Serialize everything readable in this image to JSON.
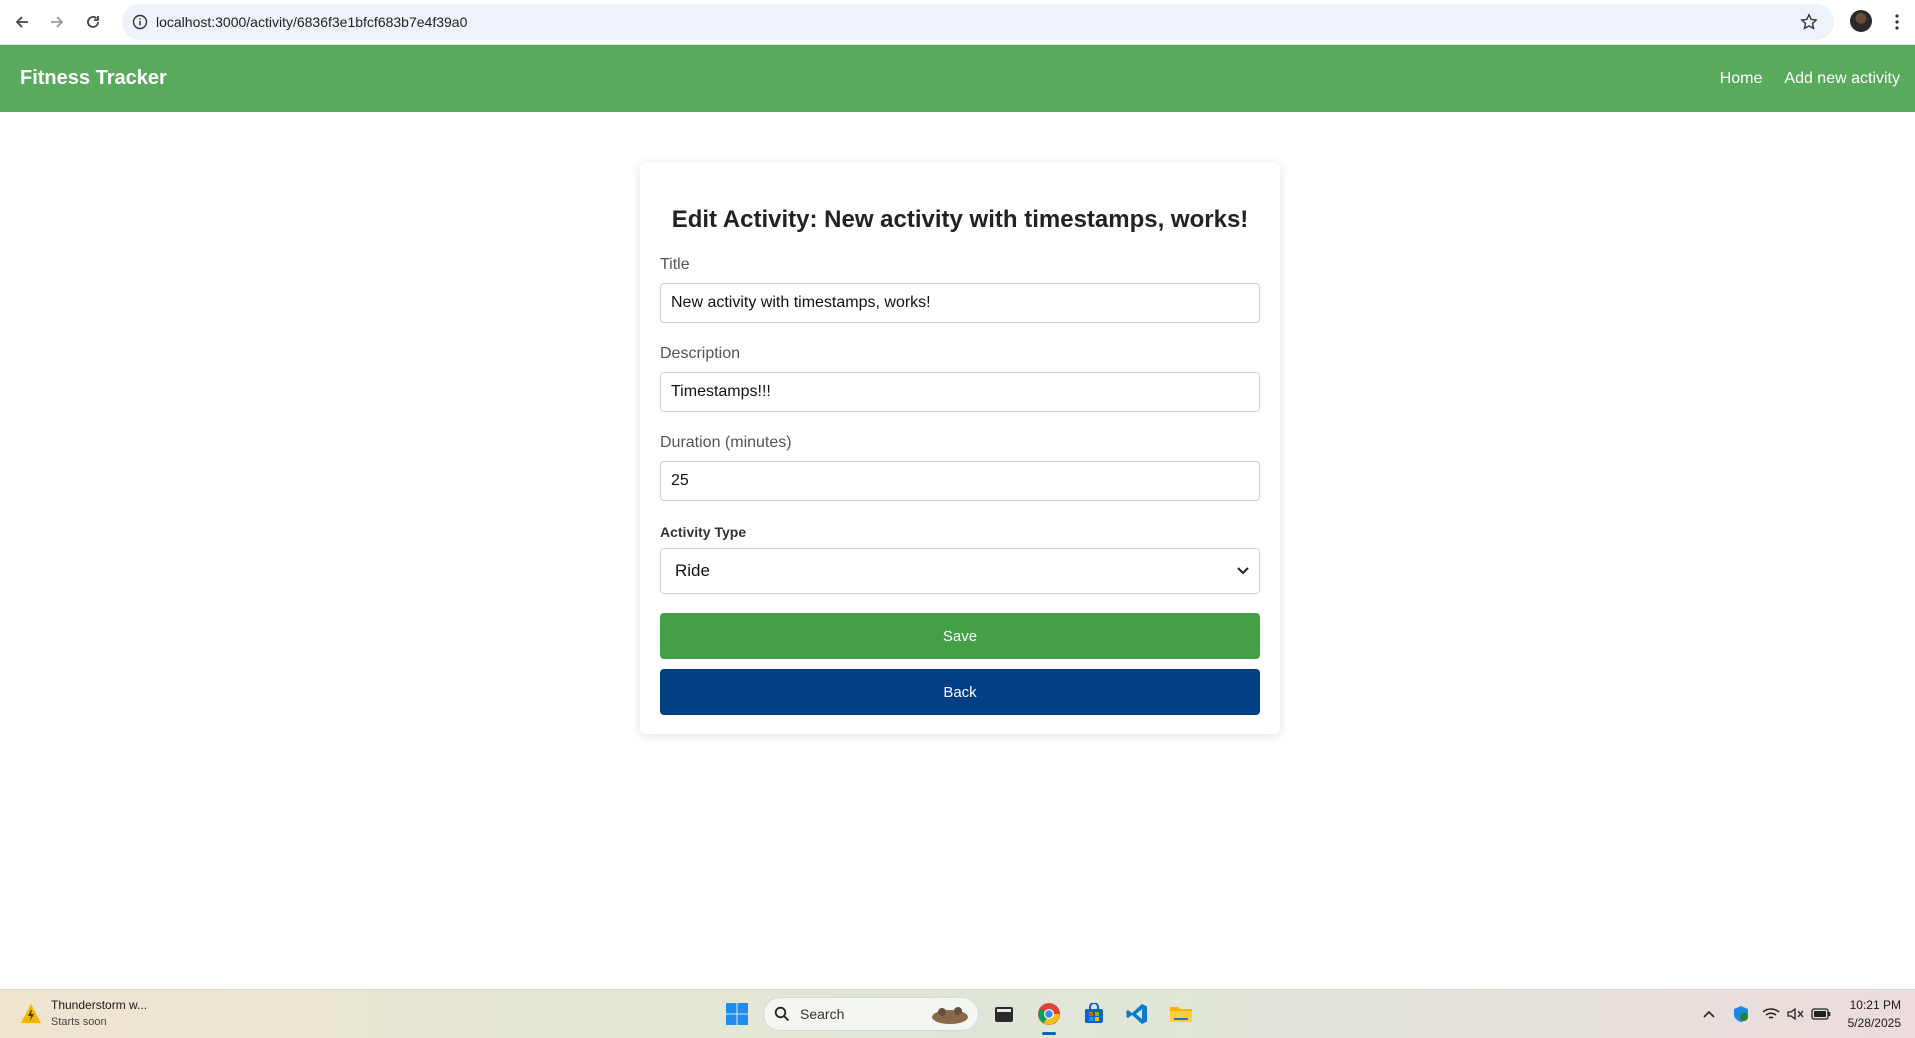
{
  "browser": {
    "url": "localhost:3000/activity/6836f3e1bfcf683b7e4f39a0"
  },
  "navbar": {
    "brand": "Fitness Tracker",
    "links": [
      "Home",
      "Add new activity"
    ]
  },
  "form": {
    "heading": "Edit Activity: New activity with timestamps, works!",
    "title_label": "Title",
    "title_value": "New activity with timestamps, works!",
    "description_label": "Description",
    "description_value": "Timestamps!!!",
    "duration_label": "Duration (minutes)",
    "duration_value": "25",
    "type_label": "Activity Type",
    "type_value": "Ride",
    "save_label": "Save",
    "back_label": "Back"
  },
  "colors": {
    "navbar": "#5aaa5e",
    "save_button": "#43a047",
    "back_button": "#003f86"
  },
  "taskbar": {
    "weather_title": "Thunderstorm w...",
    "weather_sub": "Starts soon",
    "search_label": "Search",
    "time": "10:21 PM",
    "date": "5/28/2025"
  }
}
